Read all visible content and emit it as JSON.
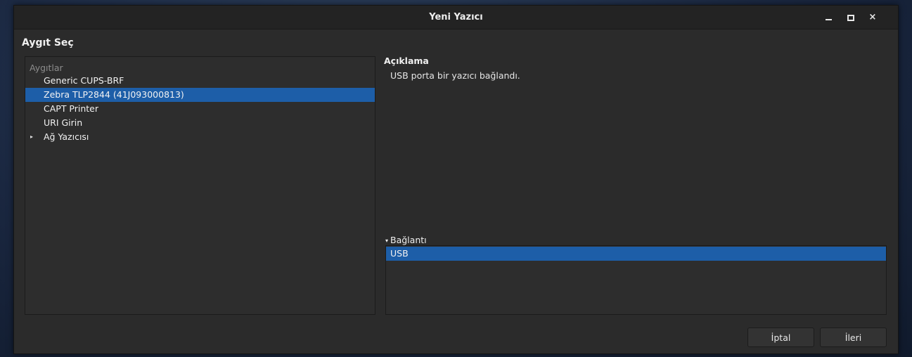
{
  "window": {
    "title": "Yeni Yazıcı",
    "minimize_icon": "minimize-icon",
    "maximize_icon": "maximize-icon",
    "close_label": "×"
  },
  "page": {
    "heading": "Aygıt Seç"
  },
  "devices": {
    "header": "Aygıtlar",
    "items": [
      {
        "label": "Generic CUPS-BRF",
        "selected": false
      },
      {
        "label": "Zebra TLP2844 (41J093000813)",
        "selected": true
      },
      {
        "label": "CAPT Printer",
        "selected": false
      },
      {
        "label": "URI Girin",
        "selected": false
      },
      {
        "label": "Ağ Yazıcısı",
        "selected": false,
        "expandable": true,
        "expander_glyph": "▸"
      }
    ]
  },
  "description": {
    "label": "Açıklama",
    "text": "USB porta bir yazıcı bağlandı."
  },
  "connection": {
    "arrow_glyph": "▾",
    "label": "Bağlantı",
    "items": [
      {
        "label": "USB",
        "selected": true
      }
    ]
  },
  "buttons": {
    "cancel": "İptal",
    "next": "İleri"
  },
  "colors": {
    "selection": "#1d5ea8",
    "window_bg": "#2b2b2b"
  }
}
